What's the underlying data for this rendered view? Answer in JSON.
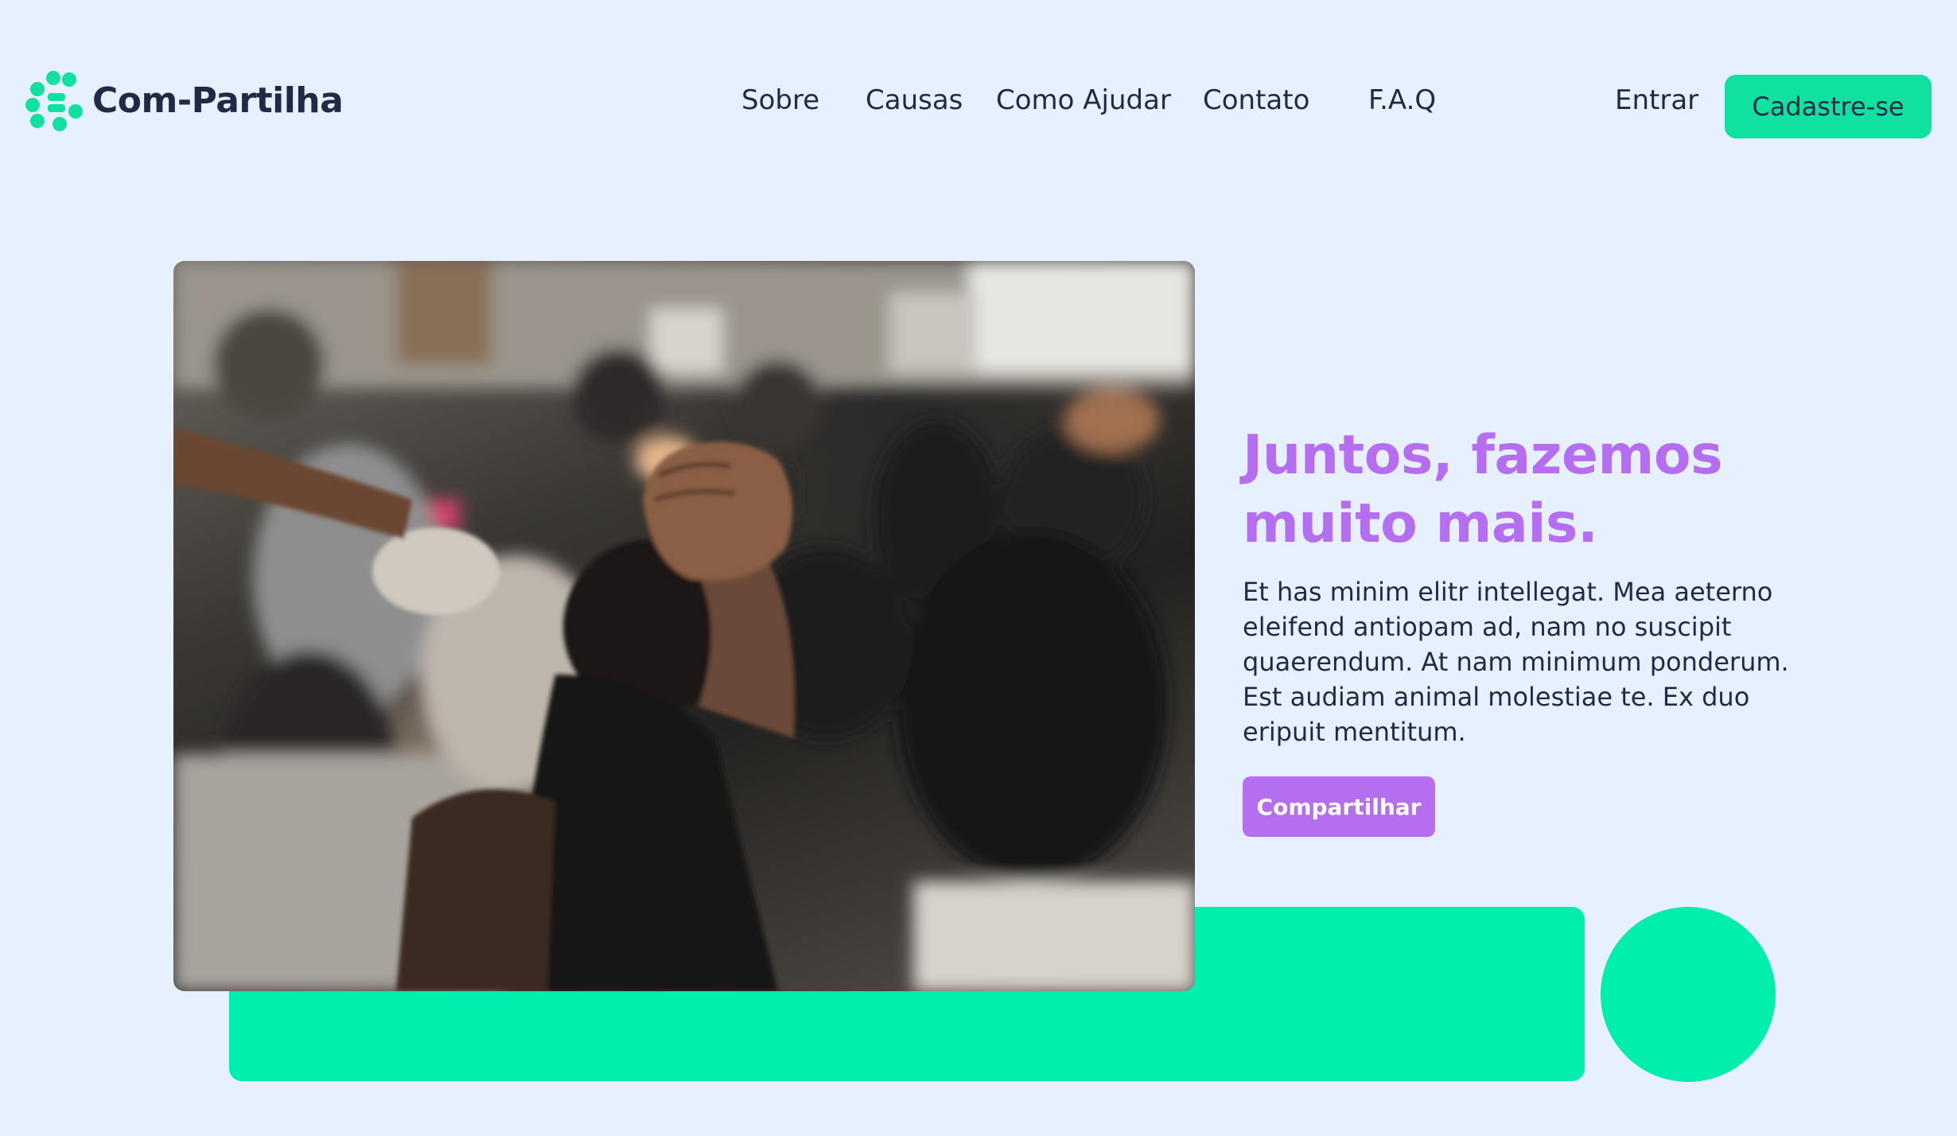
{
  "header": {
    "logo": {
      "name": "Com-Partilha",
      "icon": "dots-logo-icon"
    },
    "nav": [
      {
        "label": "Sobre"
      },
      {
        "label": "Causas"
      },
      {
        "label": "Como Ajudar"
      },
      {
        "label": "Contato"
      },
      {
        "label": "F.A.Q"
      }
    ],
    "signin_label": "Entrar",
    "signup_label": "Cadastre-se"
  },
  "hero": {
    "image": {
      "subject": "protest crowd with raised fist"
    },
    "title": "Juntos, fazemos muito mais.",
    "body": "Et has minim elitr intellegat. Mea aeterno eleifend antiopam ad, nam no suscipit quaerendum. At nam minimum ponderum. Est audiam animal molestiae te. Ex duo eripuit mentitum.",
    "cta_label": "Compartilhar"
  },
  "colors": {
    "background": "#e6f0ff",
    "accent_green": "#00eeac",
    "accent_purple": "#b56ef0",
    "text_dark": "#1f2a44"
  }
}
